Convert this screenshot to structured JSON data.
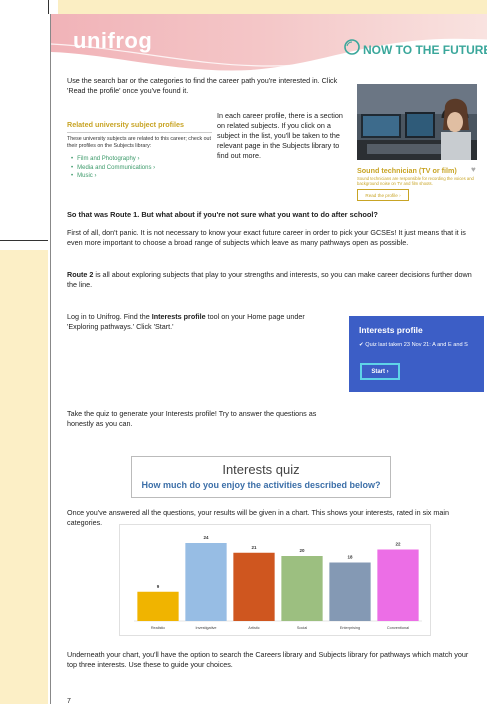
{
  "header": {
    "logo": "unifrog",
    "tagline": "NOW TO THE FUTURE"
  },
  "intro": {
    "search_text": "Use the search bar or the categories to find the career path you're interested in. Click 'Read the profile' once you've found it.",
    "related_text": "In each career profile, there is a section on related subjects. If you click on a subject in the list, you'll be taken to the relevant page in the Subjects library to find out more."
  },
  "related": {
    "heading": "Related university subject profiles",
    "description": "These university subjects are related to this career; check out their profiles on the Subjects library:",
    "items": [
      "Film and Photography ›",
      "Media and Communications ›",
      "Music ›"
    ]
  },
  "career_card": {
    "title": "Sound technician (TV or film)",
    "description": "Sound technicians are responsible for recording the voices and background noise on TV and film shoots.",
    "button": "Read the profile ›"
  },
  "route1": {
    "heading": "So that was Route 1. But what about if you're not sure what you want to do after school?",
    "para": "First of all, don't panic. It is not necessary to know your exact future career in order to pick your GCSEs! It just means that it is even more important to choose a broad range of subjects which leave as many pathways open as possible."
  },
  "route2": {
    "label": "Route 2",
    "para": " is all about exploring subjects that play to your strengths and interests, so you can make career decisions further down the line."
  },
  "login": {
    "a": "Log in to Unifrog. Find the ",
    "b": "Interests profile",
    "c": " tool on your Home page under 'Exploring pathways.' Click 'Start.'"
  },
  "interests_panel": {
    "title": "Interests profile",
    "quiz_status": "✔ Quiz last taken 23 Nov 21: A and E and S",
    "start": "Start ›"
  },
  "take_quiz": "Take the quiz to generate your Interests profile! Try to answer the questions as honestly as you can.",
  "quiz_header": {
    "title": "Interests quiz",
    "subtitle": "How much do you enjoy the activities described below?"
  },
  "chart_intro": "Once you've answered all the questions, your results will be given in a chart. This shows your interests, rated in six main categories.",
  "chart_data": {
    "type": "bar",
    "categories": [
      "Realistic",
      "Investigative",
      "Artistic",
      "Social",
      "Enterprising",
      "Conventional"
    ],
    "values": [
      9,
      24,
      21,
      20,
      18,
      22
    ],
    "colors": [
      "#f0b400",
      "#97bde4",
      "#cf561f",
      "#9cbf80",
      "#8499b4",
      "#ec6ee6"
    ],
    "ylim": [
      0,
      24
    ]
  },
  "outro": "Underneath your chart, you'll have the option to search the Careers library and Subjects library for pathways which match your top three interests.  Use these to guide your choices.",
  "page_number": "7"
}
